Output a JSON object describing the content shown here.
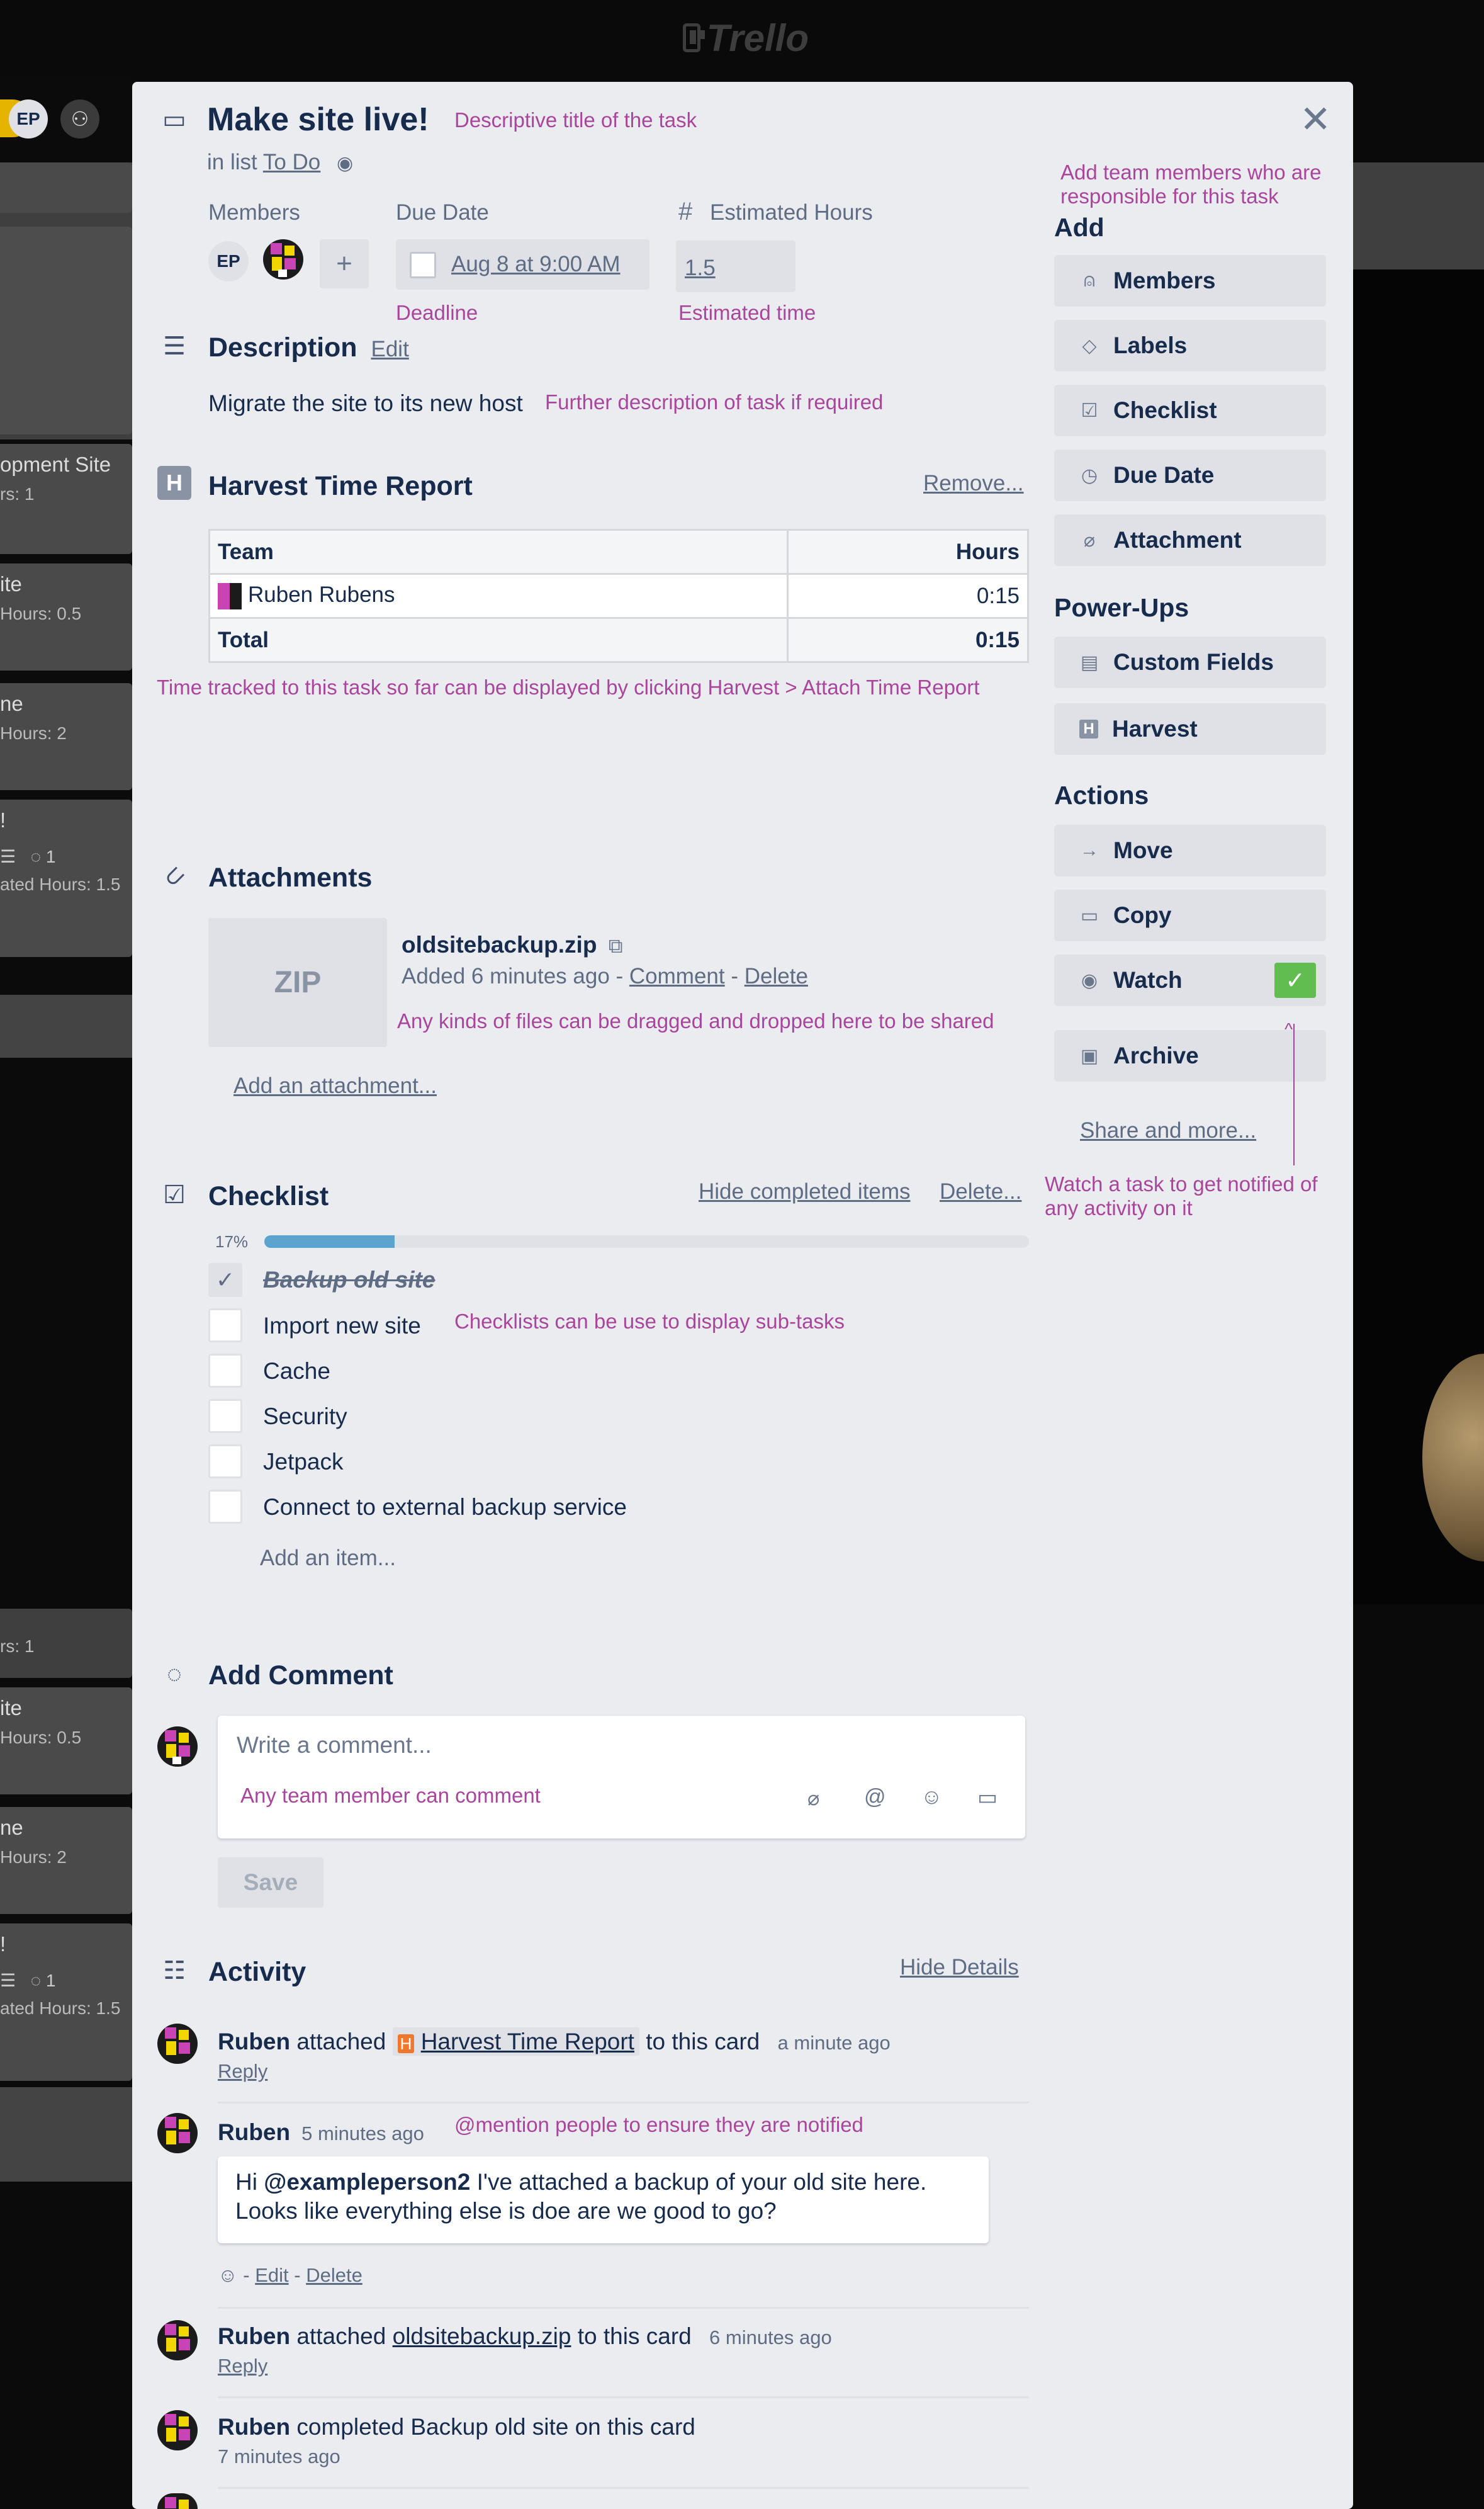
{
  "app": {
    "logo_text": "Trello"
  },
  "board_left": {
    "avatar_initials": "EP",
    "cards": [
      {
        "title": "opment Site",
        "sub": "rs: 1"
      },
      {
        "title": "ite",
        "sub": "Hours: 0.5"
      },
      {
        "title": "ne",
        "sub": "Hours: 2"
      },
      {
        "title": "!",
        "sub": "ated Hours: 1.5",
        "comments": "1"
      },
      {
        "title": "",
        "sub": "rs: 1"
      },
      {
        "title": "ite",
        "sub": "Hours: 0.5"
      },
      {
        "title": "ne",
        "sub": "Hours: 2"
      },
      {
        "title": "!",
        "sub": "ated Hours: 1.5",
        "comments": "1"
      }
    ]
  },
  "card": {
    "title": "Make site live!",
    "title_note": "Descriptive title of the task",
    "in_list_prefix": "in list",
    "list_name": "To Do",
    "members_label": "Members",
    "member_initials": "EP",
    "add_member": "+",
    "due_label": "Due Date",
    "due_value": "Aug 8 at 9:00 AM",
    "due_note": "Deadline",
    "est_label": "Estimated Hours",
    "est_value": "1.5",
    "est_note": "Estimated time",
    "description_title": "Description",
    "description_edit": "Edit",
    "description_text": "Migrate the site to its new host",
    "description_note": "Further description of task if required",
    "harvest_title": "Harvest Time Report",
    "harvest_remove": "Remove...",
    "harvest_table": {
      "headers": [
        "Team",
        "Hours"
      ],
      "rows": [
        {
          "name": "Ruben Rubens",
          "hours": "0:15"
        }
      ],
      "total_label": "Total",
      "total_hours": "0:15"
    },
    "harvest_note": "Time tracked to this task so far can be displayed by clicking Harvest > Attach Time Report",
    "attachments_title": "Attachments",
    "attachment": {
      "thumb": "ZIP",
      "name": "oldsitebackup.zip",
      "added": "Added 6 minutes ago -",
      "comment": "Comment",
      "sep": "-",
      "delete": "Delete",
      "note": "Any kinds of files can be dragged and dropped here to be shared"
    },
    "add_attachment": "Add an attachment...",
    "checklist_title": "Checklist",
    "checklist_hide": "Hide completed items",
    "checklist_delete": "Delete...",
    "checklist_percent": "17%",
    "checklist_progress": 0.17,
    "checklist_items": [
      {
        "text": "Backup old site",
        "done": true
      },
      {
        "text": "Import new site",
        "done": false
      },
      {
        "text": "Cache",
        "done": false
      },
      {
        "text": "Security",
        "done": false
      },
      {
        "text": "Jetpack",
        "done": false
      },
      {
        "text": "Connect to external backup service",
        "done": false
      }
    ],
    "checklist_note": "Checklists can be use to display sub-tasks",
    "add_item": "Add an item...",
    "comment_title": "Add Comment",
    "comment_placeholder": "Write a comment...",
    "comment_note": "Any team member can comment",
    "save": "Save",
    "activity_title": "Activity",
    "hide_details": "Hide Details",
    "activity": {
      "a1_user": "Ruben",
      "a1_mid": "attached",
      "a1_link": "Harvest Time Report",
      "a1_end": "to this card",
      "a1_time": "a minute ago",
      "a2_user": "Ruben",
      "a2_time": "5 minutes ago",
      "a2_note": "@mention people to ensure they are notified",
      "a2_hi": "Hi",
      "a2_mention": "@exampleperson2",
      "a2_line1": "I've attached a backup of your old site here.",
      "a2_line2": "Looks like everything else is doe are we good to go?",
      "a2_edit": "Edit",
      "a2_delete": "Delete",
      "a3_user": "Ruben",
      "a3_mid": "attached",
      "a3_link": "oldsitebackup.zip",
      "a3_end": "to this card",
      "a3_time": "6 minutes ago",
      "a4_user": "Ruben",
      "a4_text": "completed Backup old site on this card",
      "a4_time": "7 minutes ago",
      "reply": "Reply"
    }
  },
  "sidebar": {
    "add_note": "Add team members who are responsible for this task",
    "add_heading": "Add",
    "add_buttons": [
      "Members",
      "Labels",
      "Checklist",
      "Due Date",
      "Attachment"
    ],
    "powerups_heading": "Power-Ups",
    "powerup_buttons": [
      "Custom Fields",
      "Harvest"
    ],
    "actions_heading": "Actions",
    "action_buttons": [
      "Move",
      "Copy",
      "Watch",
      "Archive"
    ],
    "share": "Share and more...",
    "watch_note": "Watch a task to get notified of any activity on it"
  },
  "colors": {
    "accent": "#a9469c",
    "progress": "#5ba4cf",
    "watch": "#61bd4f"
  }
}
